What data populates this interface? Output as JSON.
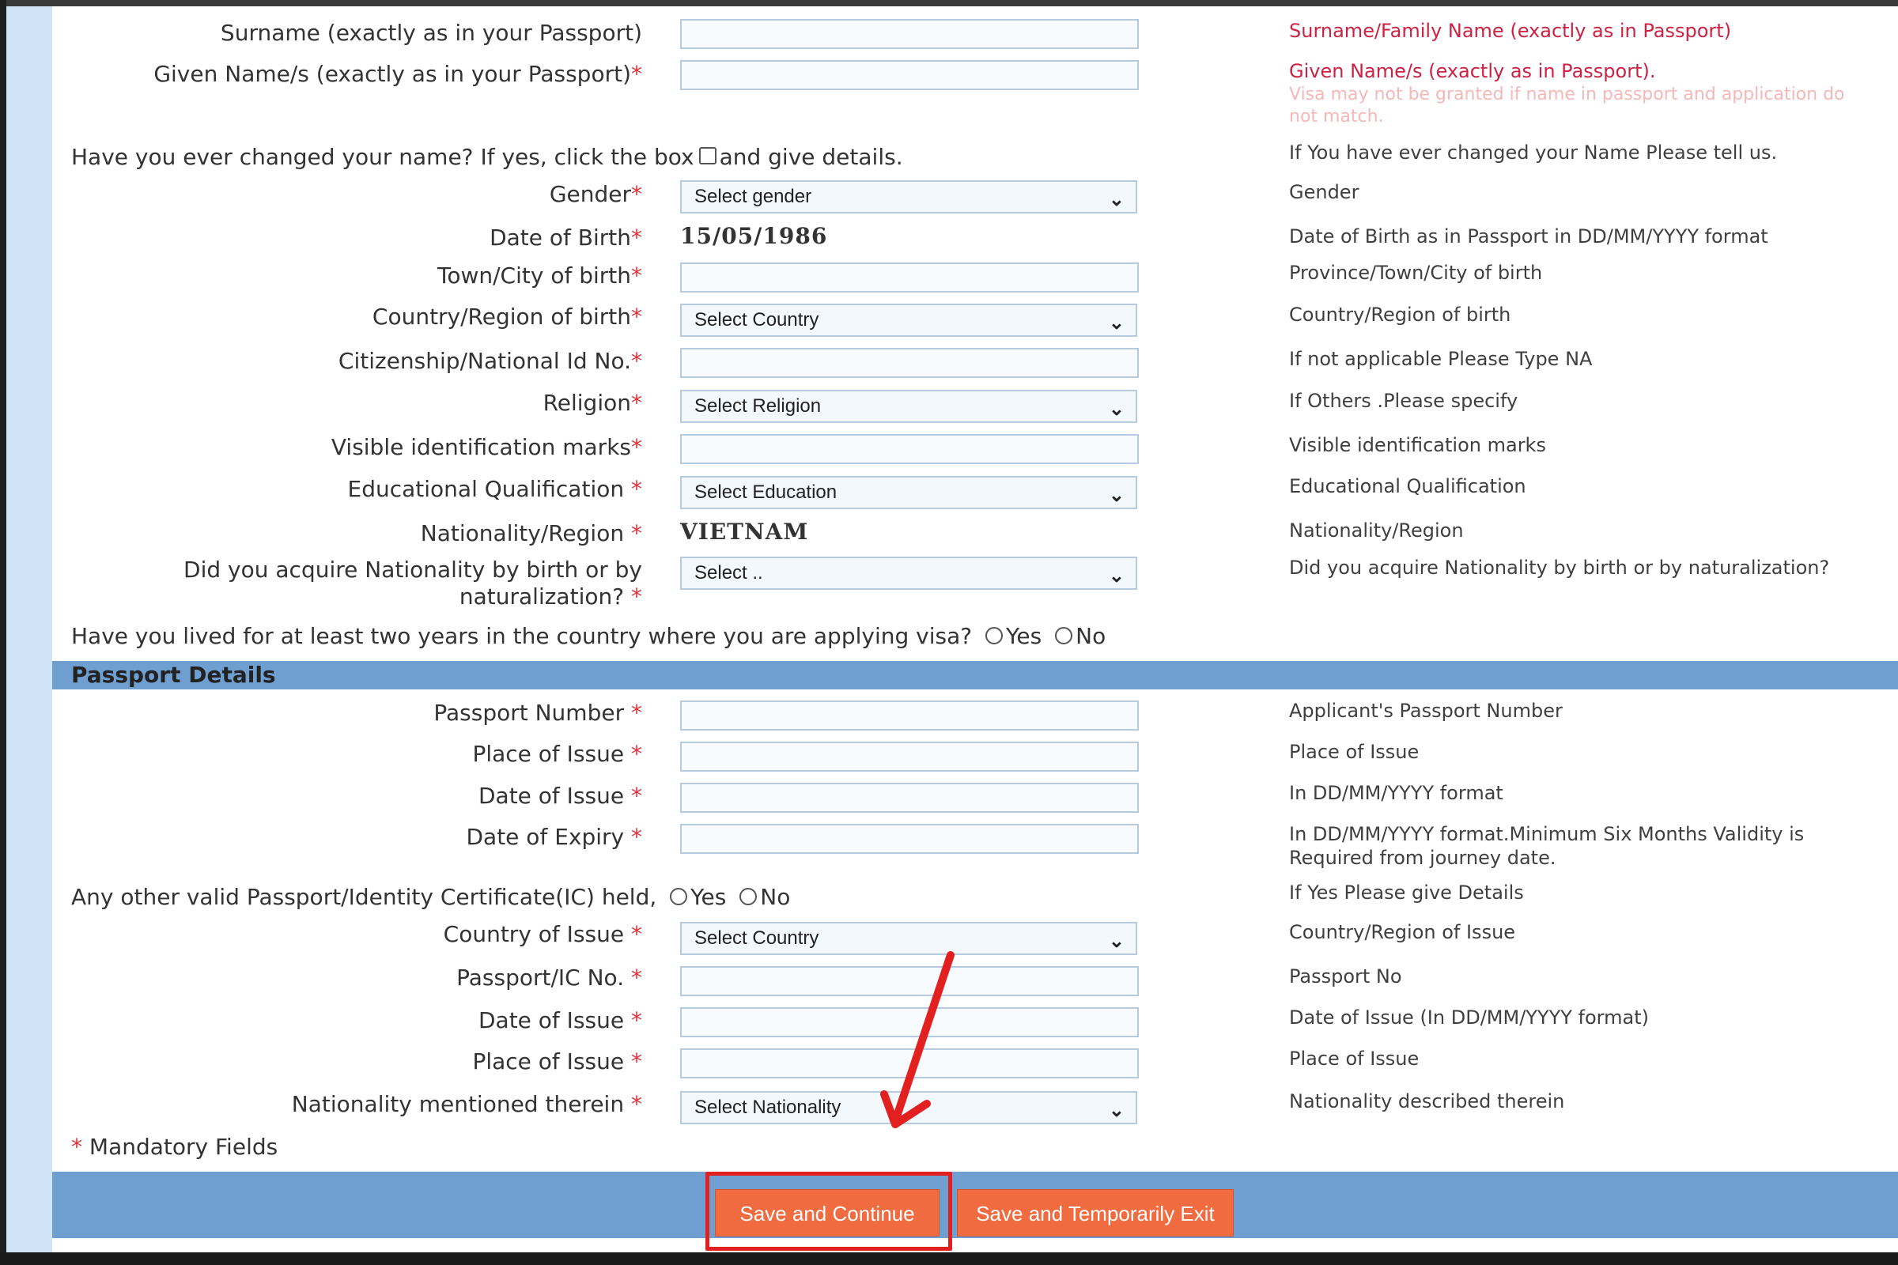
{
  "personal": {
    "surname": {
      "label": "Surname (exactly as in your Passport)",
      "help": "Surname/Family Name (exactly as in Passport)"
    },
    "given_name": {
      "label": "Given Name/s (exactly as in your Passport)",
      "help": "Given Name/s (exactly as in Passport).",
      "warning": "Visa may not be granted if name in passport and application do not match."
    },
    "changed_name": {
      "label": "Have you ever changed your name? If yes, click the box",
      "after": "and give details.",
      "help": "If You have ever changed your Name Please tell us."
    },
    "gender": {
      "label": "Gender",
      "selected": "Select gender",
      "help": "Gender"
    },
    "dob": {
      "label": "Date of Birth",
      "value": "15/05/1986",
      "help": "Date of Birth as in Passport in DD/MM/YYYY format"
    },
    "town": {
      "label": "Town/City of birth",
      "help": "Province/Town/City of birth"
    },
    "country_birth": {
      "label": "Country/Region of birth",
      "selected": "Select Country",
      "help": "Country/Region of birth"
    },
    "citizenship": {
      "label": "Citizenship/National Id No.",
      "help": "If not applicable Please Type NA"
    },
    "religion": {
      "label": "Religion",
      "selected": "Select Religion",
      "help": "If Others .Please specify"
    },
    "marks": {
      "label": "Visible identification marks",
      "help": "Visible identification marks"
    },
    "education": {
      "label": "Educational Qualification",
      "selected": "Select Education",
      "help": "Educational Qualification"
    },
    "nationality": {
      "label": "Nationality/Region",
      "value": "VIETNAM",
      "help": "Nationality/Region"
    },
    "acquire": {
      "label": "Did you acquire Nationality by birth or by naturalization?",
      "selected": "Select ..",
      "help": "Did you acquire Nationality by birth or by naturalization?"
    },
    "lived": {
      "label": "Have you lived for at least two years in the country where you are applying visa?",
      "yes": "Yes",
      "no": "No"
    }
  },
  "passport_section": {
    "title": "Passport Details",
    "number": {
      "label": "Passport Number",
      "help": "Applicant's Passport Number"
    },
    "place": {
      "label": "Place of Issue",
      "help": "Place of Issue"
    },
    "date_issue": {
      "label": "Date of Issue",
      "help": "In DD/MM/YYYY format"
    },
    "date_expiry": {
      "label": "Date of Expiry",
      "help": "In DD/MM/YYYY format.Minimum Six Months Validity is Required from journey date."
    },
    "other": {
      "label": "Any other valid Passport/Identity Certificate(IC) held,",
      "yes": "Yes",
      "no": "No",
      "help": "If Yes Please give Details"
    },
    "other_country": {
      "label": "Country of Issue",
      "selected": "Select Country",
      "help": "Country/Region of Issue"
    },
    "other_no": {
      "label": "Passport/IC No.",
      "help": "Passport No"
    },
    "other_date": {
      "label": "Date of Issue",
      "help": "Date of Issue (In DD/MM/YYYY format)"
    },
    "other_place": {
      "label": "Place of Issue",
      "help": "Place of Issue"
    },
    "other_nationality": {
      "label": "Nationality mentioned therein",
      "selected": "Select Nationality",
      "help": "Nationality described therein"
    }
  },
  "mandatory_note": "Mandatory Fields",
  "asterisk": "*",
  "buttons": {
    "save_continue": "Save and Continue",
    "save_exit": "Save and Temporarily Exit"
  },
  "colors": {
    "section_bar": "#6f9fd0",
    "button": "#f06b3f",
    "highlight": "#e32020",
    "required": "#e0333c"
  }
}
